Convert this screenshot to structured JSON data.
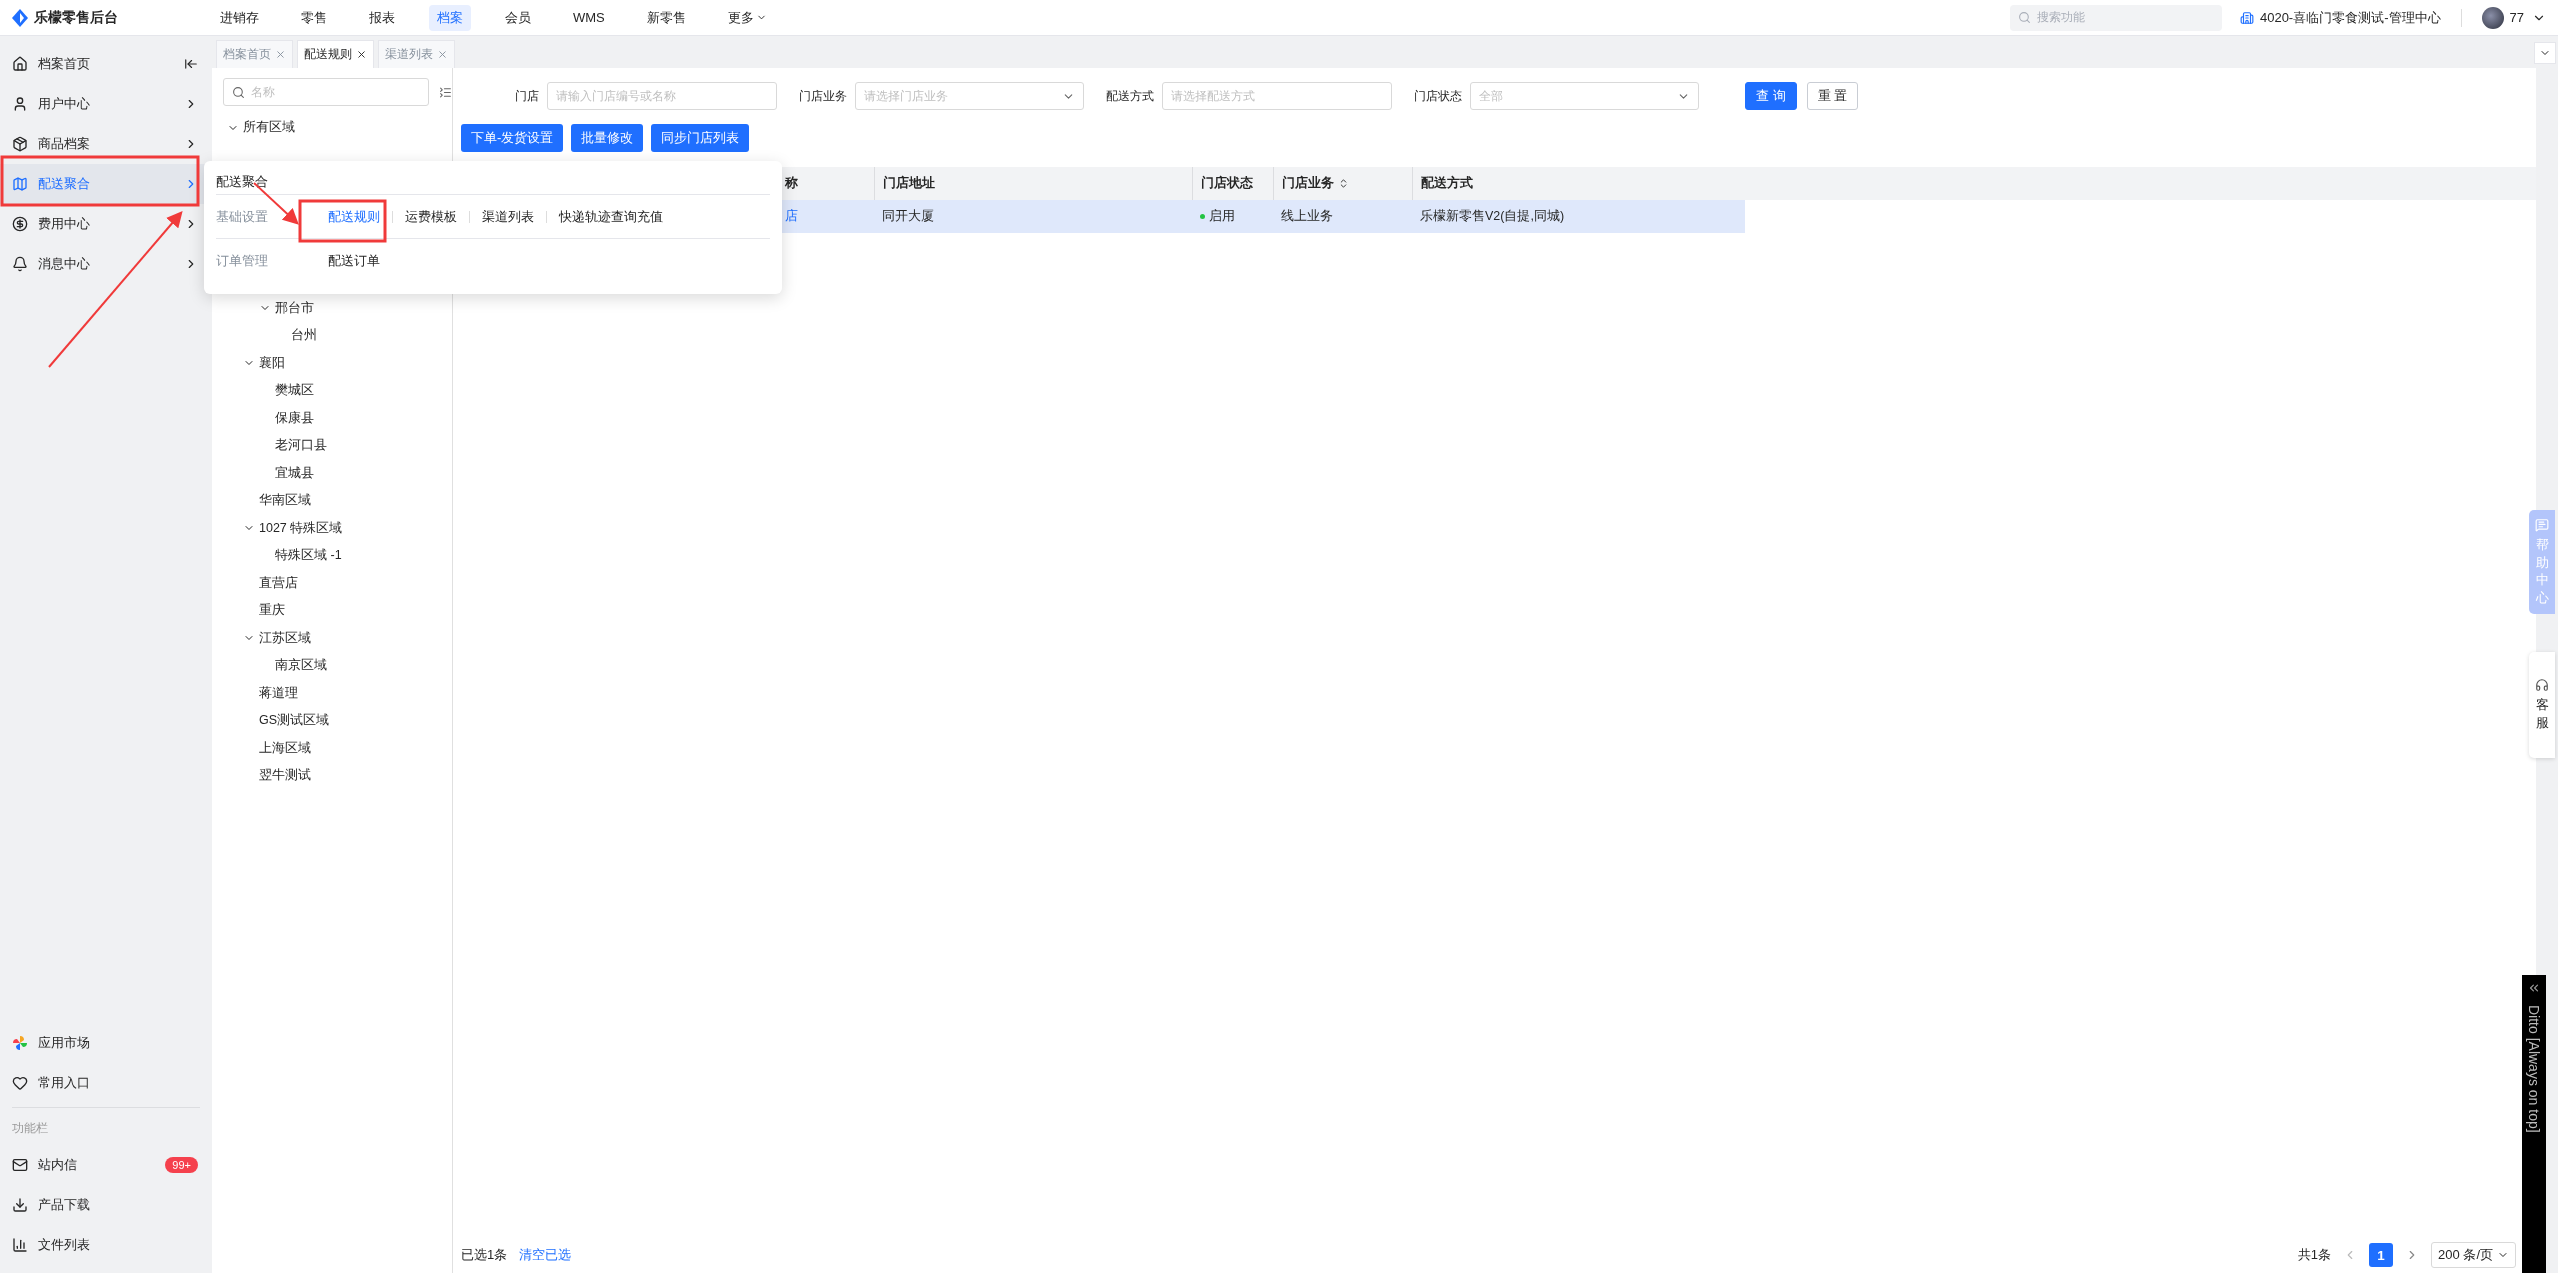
{
  "app": {
    "logo_text": "乐檬零售后台"
  },
  "top_nav": [
    {
      "label": "进销存",
      "selected": false,
      "has_menu": false
    },
    {
      "label": "零售",
      "selected": false,
      "has_menu": false
    },
    {
      "label": "报表",
      "selected": false,
      "has_menu": false
    },
    {
      "label": "档案",
      "selected": true,
      "has_menu": false
    },
    {
      "label": "会员",
      "selected": false,
      "has_menu": false
    },
    {
      "label": "WMS",
      "selected": false,
      "has_menu": false
    },
    {
      "label": "新零售",
      "selected": false,
      "has_menu": false
    },
    {
      "label": "更多",
      "selected": false,
      "has_menu": true
    }
  ],
  "global_search": {
    "placeholder": "搜索功能"
  },
  "store": {
    "name": "4020-喜临门零食测试-管理中心"
  },
  "user": {
    "name": "77"
  },
  "sidebar": {
    "items": [
      {
        "label": "档案首页",
        "selected": false
      },
      {
        "label": "用户中心",
        "selected": false
      },
      {
        "label": "商品档案",
        "selected": false
      },
      {
        "label": "配送聚合",
        "selected": true
      },
      {
        "label": "费用中心",
        "selected": false
      },
      {
        "label": "消息中心",
        "selected": false
      }
    ],
    "bottom_items": [
      {
        "label": "应用市场"
      },
      {
        "label": "常用入口"
      }
    ],
    "section_title": "功能栏",
    "tool_items": [
      {
        "label": "站内信",
        "badge": "99+"
      },
      {
        "label": "产品下载"
      },
      {
        "label": "文件列表"
      }
    ]
  },
  "tabs": [
    {
      "label": "档案首页",
      "selected": false
    },
    {
      "label": "配送规则",
      "selected": true
    },
    {
      "label": "渠道列表",
      "selected": false
    }
  ],
  "tree": {
    "search_placeholder": "名称",
    "nodes": [
      {
        "label": "所有区域",
        "expanded": true,
        "children": [
          {
            "children": [
              {
                "label": "邢台市",
                "expanded": true,
                "children": [
                  {
                    "label": "台州"
                  }
                ]
              }
            ]
          },
          {
            "label": "襄阳",
            "expanded": true,
            "children": [
              {
                "label": "樊城区"
              },
              {
                "label": "保康县"
              },
              {
                "label": "老河口县"
              },
              {
                "label": "宜城县"
              }
            ]
          },
          {
            "label": "华南区域"
          },
          {
            "label": "1027 特殊区域",
            "expanded": true,
            "children": [
              {
                "label": "特殊区域 -1"
              }
            ]
          },
          {
            "label": "直营店"
          },
          {
            "label": "重庆"
          },
          {
            "label": "江苏区域",
            "expanded": true,
            "children": [
              {
                "label": "南京区域"
              }
            ]
          },
          {
            "label": "蒋道理"
          },
          {
            "label": "GS测试区域"
          },
          {
            "label": "上海区域"
          },
          {
            "label": "翌牛测试"
          }
        ]
      }
    ]
  },
  "filters": [
    {
      "label": "门店",
      "placeholder": "请输入门店编号或名称",
      "kind": "input"
    },
    {
      "label": "门店业务",
      "placeholder": "请选择门店业务",
      "kind": "select"
    },
    {
      "label": "配送方式",
      "placeholder": "请选择配送方式",
      "kind": "input"
    },
    {
      "label": "门店状态",
      "placeholder": "全部",
      "kind": "select"
    }
  ],
  "filter_buttons": [
    {
      "label": "查 询",
      "kind": "primary"
    },
    {
      "label": "重 置",
      "kind": "default"
    }
  ],
  "actions": [
    "下单-发货设置",
    "批量修改",
    "同步门店列表"
  ],
  "table": {
    "columns": [
      {
        "label": "称",
        "sortable": false
      },
      {
        "label": "门店地址",
        "sortable": false
      },
      {
        "label": "门店状态",
        "sortable": false
      },
      {
        "label": "门店业务",
        "sortable": true
      },
      {
        "label": "配送方式",
        "sortable": false
      }
    ],
    "rows": [
      {
        "selected": true,
        "store": "店",
        "address": "同开大厦",
        "status": {
          "label": "启用",
          "color": "#23c343"
        },
        "business": "线上业务",
        "delivery": "乐檬新零售V2(自提,同城)"
      }
    ]
  },
  "footer": {
    "selected_text": "已选1条",
    "clear_link": "清空已选",
    "total": "共1条",
    "pages": [
      {
        "label": "1",
        "selected": true
      }
    ],
    "page_size": "200 条/页"
  },
  "popup": {
    "title": "配送聚合",
    "groups": [
      {
        "label": "基础设置",
        "links": [
          {
            "label": "配送规则",
            "selected": true
          },
          {
            "label": "运费模板",
            "selected": false
          },
          {
            "label": "渠道列表",
            "selected": false
          },
          {
            "label": "快递轨迹查询充值",
            "selected": false
          }
        ]
      },
      {
        "label": "订单管理",
        "links": [
          {
            "label": "配送订单",
            "selected": false
          }
        ]
      }
    ]
  },
  "help_center": {
    "label": "帮助中心"
  },
  "customer_service": {
    "label": "客服"
  },
  "ditto": {
    "title": "Ditto [Always on top]"
  }
}
